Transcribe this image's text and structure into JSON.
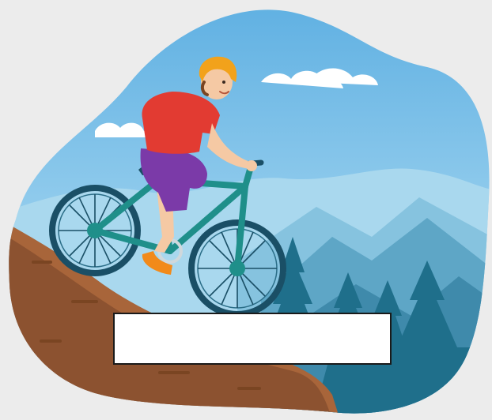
{
  "scene": {
    "subject": "mountain-biker",
    "colors": {
      "page_background": "#ececec",
      "sky_top": "#5fb0e2",
      "sky_bottom": "#bfe5f7",
      "cloud": "#ffffff",
      "mountain_far": "#9ed2ea",
      "mountain_mid": "#74b8d6",
      "mountain_near": "#4f97b7",
      "pine_trees": "#1f6f8b",
      "hill_dirt": "#a8653a",
      "hill_dirt_dark": "#7a4522",
      "bike_frame": "#1f8f8a",
      "wheel_tire": "#1a4f66",
      "shirt": "#e23b32",
      "shorts": "#7b3aa8",
      "helmet": "#f2a21b",
      "skin": "#f5c9a4",
      "shoes": "#f28a1a"
    }
  },
  "label_box": {
    "text": ""
  }
}
